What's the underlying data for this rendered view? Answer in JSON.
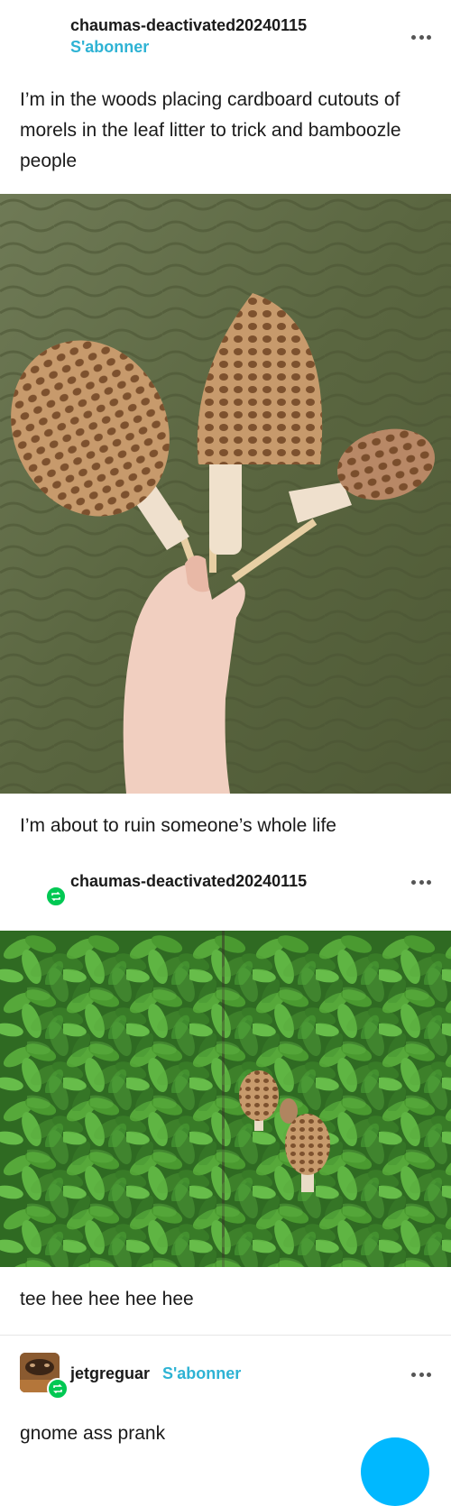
{
  "post1": {
    "username": "chaumas-deactivated20240115",
    "follow_label": "S'abonner",
    "text": "I’m in the woods placing cardboard cutouts of morels in the leaf litter to trick and bamboozle people",
    "caption_after_photo": "I’m about to ruin someone’s whole life"
  },
  "post2": {
    "username": "chaumas-deactivated20240115",
    "text": "tee hee hee hee hee"
  },
  "post3": {
    "username": "jetgreguar",
    "follow_label": "S'abonner",
    "text": "gnome ass prank"
  },
  "colors": {
    "accent": "#2eb3d4",
    "reblog": "#00c853",
    "carpet": "#5f6b45",
    "foliage": "#3f8a2e",
    "fab": "#00b8ff"
  }
}
